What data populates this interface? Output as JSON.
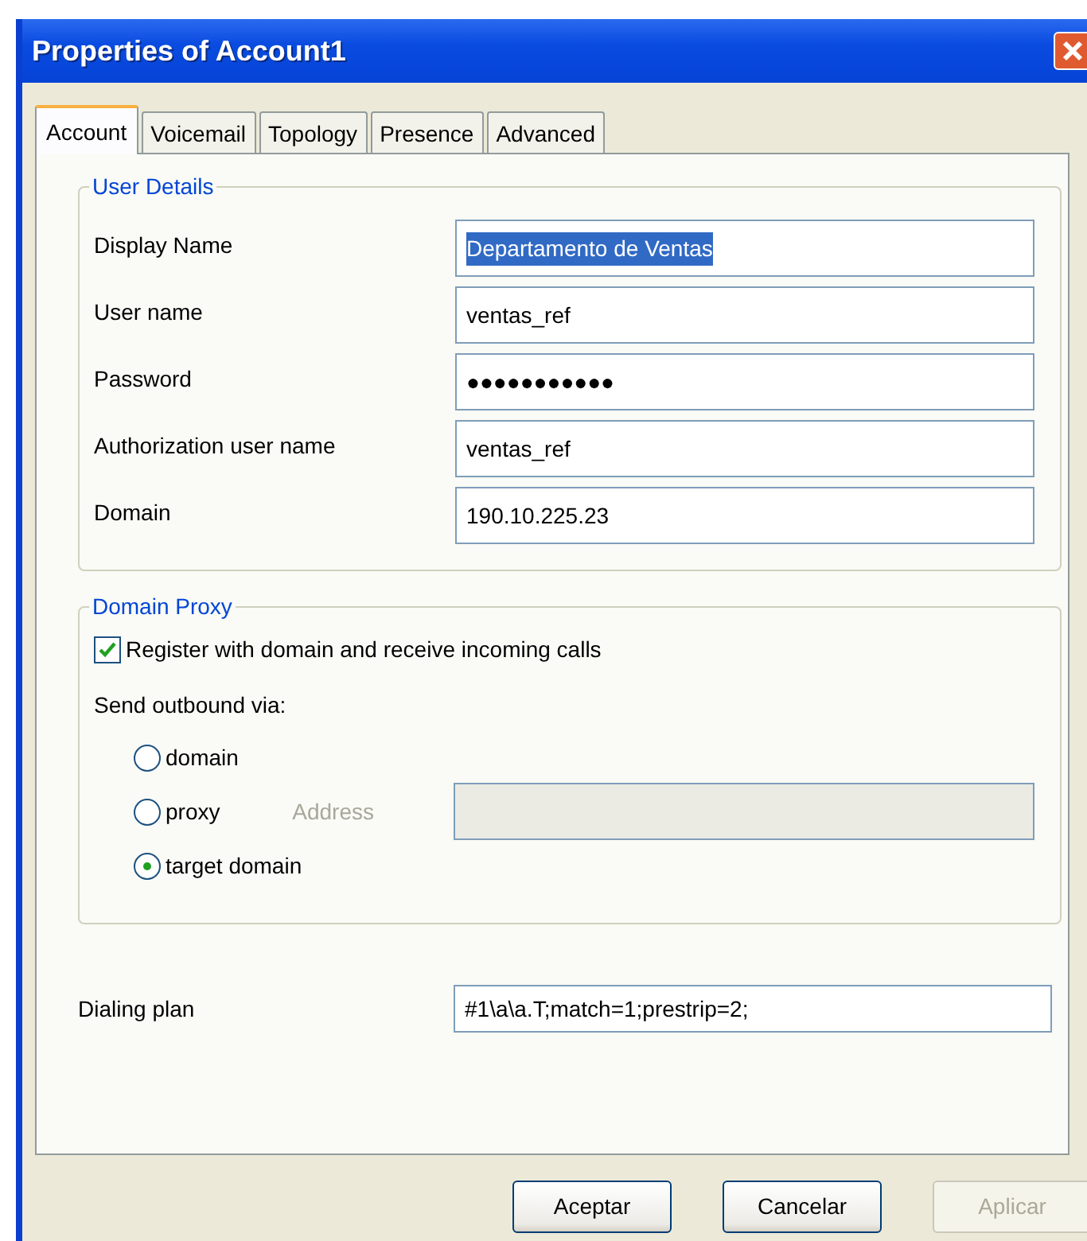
{
  "window": {
    "title": "Properties of Account1"
  },
  "tabs": [
    {
      "label": "Account",
      "selected": true
    },
    {
      "label": "Voicemail",
      "selected": false
    },
    {
      "label": "Topology",
      "selected": false
    },
    {
      "label": "Presence",
      "selected": false
    },
    {
      "label": "Advanced",
      "selected": false
    }
  ],
  "user_details": {
    "title": "User Details",
    "fields": [
      {
        "label": "Display Name",
        "value": "Departamento de Ventas",
        "text_selected": true
      },
      {
        "label": "User name",
        "value": "ventas_ref",
        "text_selected": false
      },
      {
        "label": "Password",
        "value": "●●●●●●●●●●●",
        "text_selected": false
      },
      {
        "label": "Authorization user name",
        "value": "ventas_ref",
        "text_selected": false
      },
      {
        "label": "Domain",
        "value": "190.10.225.23",
        "text_selected": false
      }
    ]
  },
  "domain_proxy": {
    "title": "Domain Proxy",
    "register": {
      "label": "Register with domain and receive incoming calls",
      "checked": true
    },
    "send_label": "Send outbound via:",
    "options": [
      {
        "label": "domain",
        "selected": false
      },
      {
        "label": "proxy",
        "selected": false
      },
      {
        "label": "target domain",
        "selected": true
      }
    ],
    "address": {
      "label": "Address",
      "disabled": true
    }
  },
  "dialing_plan": {
    "label": "Dialing plan",
    "value": "#1\\a\\a.T;match=1;prestrip=2;"
  },
  "buttons": [
    {
      "label": "Aceptar",
      "disabled": false
    },
    {
      "label": "Cancelar",
      "disabled": false
    },
    {
      "label": "Aplicar",
      "disabled": true
    }
  ]
}
